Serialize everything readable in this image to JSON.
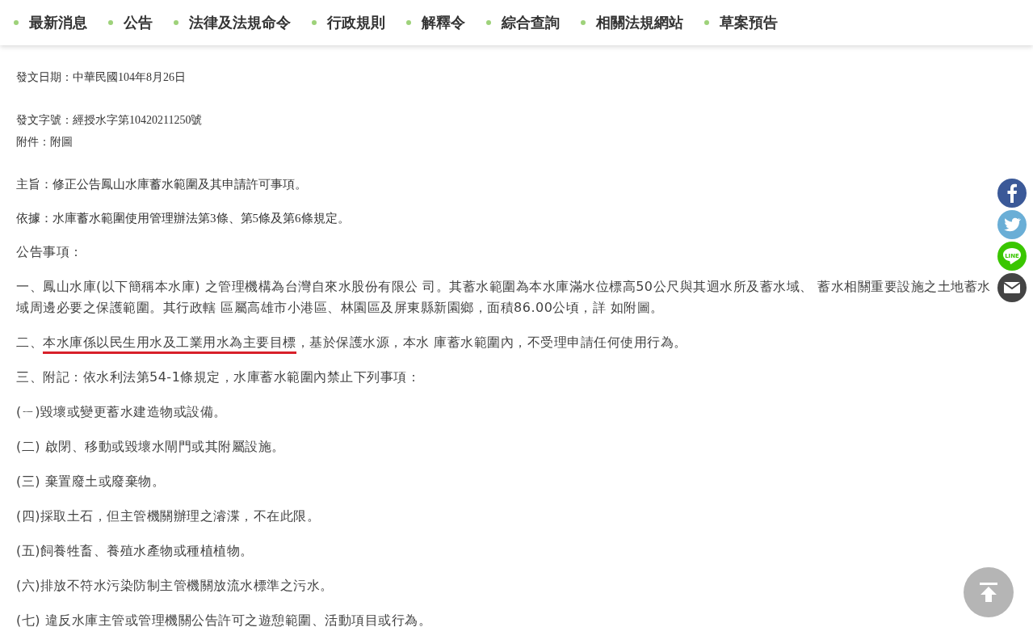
{
  "nav": {
    "items": [
      {
        "label": "最新消息"
      },
      {
        "label": "公告"
      },
      {
        "label": "法律及法規命令"
      },
      {
        "label": "行政規則"
      },
      {
        "label": "解釋令"
      },
      {
        "label": "綜合查詢"
      },
      {
        "label": "相關法規網站"
      },
      {
        "label": "草案預告"
      }
    ]
  },
  "header": [
    {
      "lines": [
        "發文日期：中華民國104年8月26日"
      ]
    },
    {
      "lines": [
        "發文字號：經授水字第10420211250號",
        "附件：附圖"
      ]
    }
  ],
  "body": [
    {
      "kind": "header",
      "text": "主旨：修正公告鳳山水庫蓄水範圍及其申請許可事項。"
    },
    {
      "kind": "header",
      "text": "依據：水庫蓄水範圍使用管理辦法第3條、第5條及第6條規定。"
    },
    {
      "kind": "plain",
      "parts": [
        {
          "text": "公告事項：",
          "underlined": false
        }
      ]
    },
    {
      "kind": "plain",
      "parts": [
        {
          "text": "一、鳳山水庫(以下簡稱本水庫) 之管理機構為台灣自來水股份有限公 司。其蓄水範圍為本水庫滿水位標高50公尺與其迴水所及蓄水域、 蓄水相關重要設施之土地蓄水域周邊必要之保護範圍。其行政轄 區屬高雄市小港區、林園區及屏東縣新園鄉，面積86.00公頃，詳 如附圖。",
          "underlined": false
        }
      ]
    },
    {
      "kind": "plain",
      "parts": [
        {
          "text": "二、",
          "underlined": false
        },
        {
          "text": "本水庫係以民生用水及工業用水為主要目標",
          "underlined": true
        },
        {
          "text": "，基於保護水源，本水 庫蓄水範圍內，不受理申請任何使用行為。",
          "underlined": false
        }
      ]
    },
    {
      "kind": "plain",
      "parts": [
        {
          "text": "三、附記：依水利法第54-1條規定，水庫蓄水範圍內禁止下列事項：",
          "underlined": false
        }
      ]
    },
    {
      "kind": "plain",
      "parts": [
        {
          "text": "(ㄧ)毀壞或變更蓄水建造物或設備。",
          "underlined": false
        }
      ]
    },
    {
      "kind": "plain",
      "parts": [
        {
          "text": "(二) 啟閉、移動或毀壞水閘門或其附屬設施。",
          "underlined": false
        }
      ]
    },
    {
      "kind": "plain",
      "parts": [
        {
          "text": "(三) 棄置廢土或廢棄物。",
          "underlined": false
        }
      ]
    },
    {
      "kind": "plain",
      "parts": [
        {
          "text": "(四)採取土石，但主管機關辦理之濬渫，不在此限。",
          "underlined": false
        }
      ]
    },
    {
      "kind": "plain",
      "parts": [
        {
          "text": "(五)飼養牲畜、養殖水產物或種植植物。",
          "underlined": false
        }
      ]
    },
    {
      "kind": "plain",
      "parts": [
        {
          "text": "(六)排放不符水污染防制主管機關放流水標準之污水。",
          "underlined": false
        }
      ]
    },
    {
      "kind": "plain",
      "parts": [
        {
          "text": "(七) 違反水庫主管或管理機關公告許可之遊憩範圍、活動項目或行為。",
          "underlined": false
        }
      ]
    }
  ],
  "share": [
    {
      "kind": "facebook"
    },
    {
      "kind": "twitter"
    },
    {
      "kind": "line",
      "label": "LINE"
    },
    {
      "kind": "mail"
    }
  ]
}
